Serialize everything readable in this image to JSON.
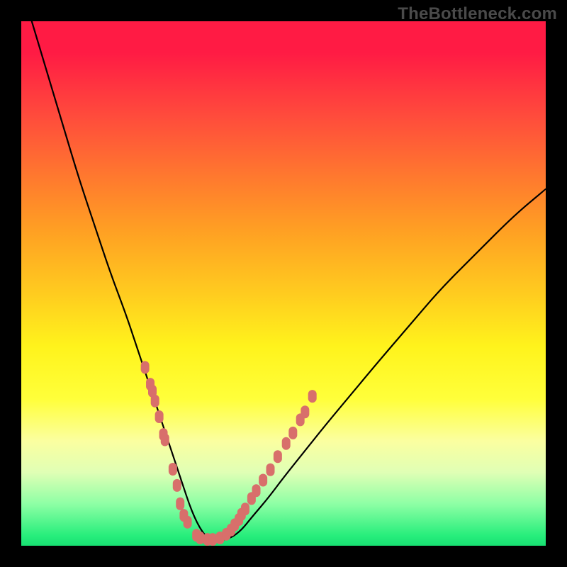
{
  "watermark": "TheBottleneck.com",
  "chart_data": {
    "type": "line",
    "title": "",
    "xlabel": "",
    "ylabel": "",
    "xlim": [
      0,
      100
    ],
    "ylim": [
      0,
      100
    ],
    "grid": false,
    "series": [
      {
        "name": "bottleneck-curve",
        "color": "#000000",
        "x": [
          2,
          5,
          8,
          11,
          14,
          17,
          20,
          22,
          24,
          26,
          28,
          30,
          31,
          32,
          33,
          34,
          35,
          36.5,
          38,
          40,
          42,
          44,
          47,
          50,
          54,
          58,
          63,
          68,
          74,
          80,
          87,
          94,
          100
        ],
        "y": [
          100,
          90,
          80,
          70,
          61,
          52,
          44,
          38,
          32,
          26,
          20,
          14,
          11,
          8,
          5.5,
          3.5,
          2,
          1,
          1,
          1.5,
          3,
          5.5,
          9,
          13,
          18,
          23,
          29,
          35,
          42,
          49,
          56,
          63,
          68
        ]
      },
      {
        "name": "highlight-dots-left",
        "color": "#d86f6b",
        "x": [
          23.6,
          24.6,
          25.0,
          25.5,
          26.3,
          27.1,
          27.4,
          28.9,
          29.7
        ],
        "y": [
          34.0,
          30.8,
          29.5,
          27.6,
          24.6,
          21.2,
          20.2,
          14.6,
          11.5
        ]
      },
      {
        "name": "highlight-dots-bottom",
        "color": "#d86f6b",
        "x": [
          30.3,
          31.0,
          31.7,
          33.4,
          34.1,
          35.5,
          36.5,
          37.9,
          39.1,
          40.0,
          40.7,
          41.5,
          42.0,
          42.7
        ],
        "y": [
          8.0,
          5.8,
          4.5,
          2.0,
          1.5,
          1.2,
          1.2,
          1.5,
          2.2,
          3.0,
          4.0,
          5.0,
          6.0,
          7.0
        ]
      },
      {
        "name": "highlight-dots-right",
        "color": "#d86f6b",
        "x": [
          43.9,
          44.8,
          46.1,
          47.5,
          48.9,
          50.5,
          51.8,
          53.2,
          54.1,
          55.5
        ],
        "y": [
          9.0,
          10.5,
          12.5,
          14.5,
          17.0,
          19.5,
          21.5,
          24.0,
          25.5,
          28.5
        ]
      }
    ]
  }
}
